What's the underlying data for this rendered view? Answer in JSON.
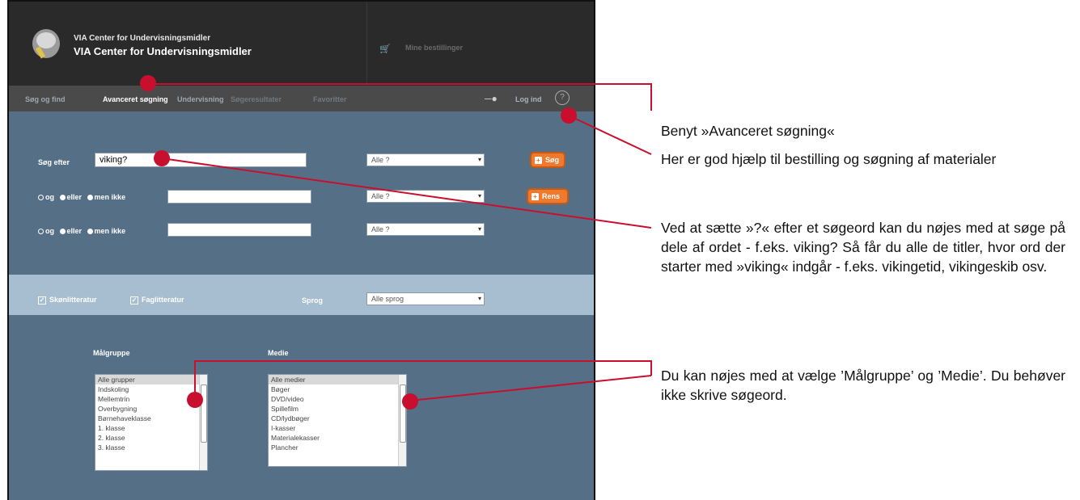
{
  "app": {
    "org_line1": "VIA Center for Undervisningsmidler",
    "org_line2": "VIA Center for Undervisningsmidler",
    "cart_label": "Mine bestillinger"
  },
  "nav": {
    "items": [
      "Søg og find",
      "Avanceret søgning",
      "Undervisning",
      "Søgeresultater",
      "Favoritter"
    ],
    "login": "Log ind",
    "help": "?"
  },
  "search": {
    "label": "Søg efter",
    "query": "viking?",
    "row2_options": [
      "og",
      "eller",
      "men ikke"
    ],
    "row3_options": [
      "og",
      "eller",
      "men ikke"
    ],
    "field_select": "Alle ?",
    "search_button": "Søg",
    "reset_button": "Rens"
  },
  "filters": {
    "fiction": "Skønlitteratur",
    "nonfiction": "Faglitteratur",
    "language_label": "Sprog",
    "language_value": "Alle sprog"
  },
  "lists": {
    "audience_title": "Målgruppe",
    "audience_items": [
      "Alle grupper",
      "Indskoling",
      "Mellemtrin",
      "Overbygning",
      "Børnehaveklasse",
      "1. klasse",
      "2. klasse",
      "3. klasse"
    ],
    "media_title": "Medie",
    "media_items": [
      "Alle medier",
      "Bøger",
      "DVD/video",
      "Spillefilm",
      "CD/lydbøger",
      "I-kasser",
      "Materialekasser",
      "Plancher"
    ]
  },
  "annotations": {
    "note1": "Benyt »Avanceret søgning«",
    "note2": "Her er god hjælp til bestilling og søgning af materialer",
    "note3": "Ved at sætte »?« efter et søgeord kan du nøjes med at søge på dele af ordet - f.eks. viking? Så får du alle de titler, hvor ord der starter med »viking« indgår - f.eks. vikingetid, vikingeskib osv.",
    "note4": "Du kan nøjes med at vælge ’Målgruppe’ og ’Medie’. Du behøver ikke skrive søgeord."
  },
  "colors": {
    "accent_orange": "#ef7a2e",
    "callout_red": "#c8102e",
    "panel_blue": "#556f86"
  }
}
